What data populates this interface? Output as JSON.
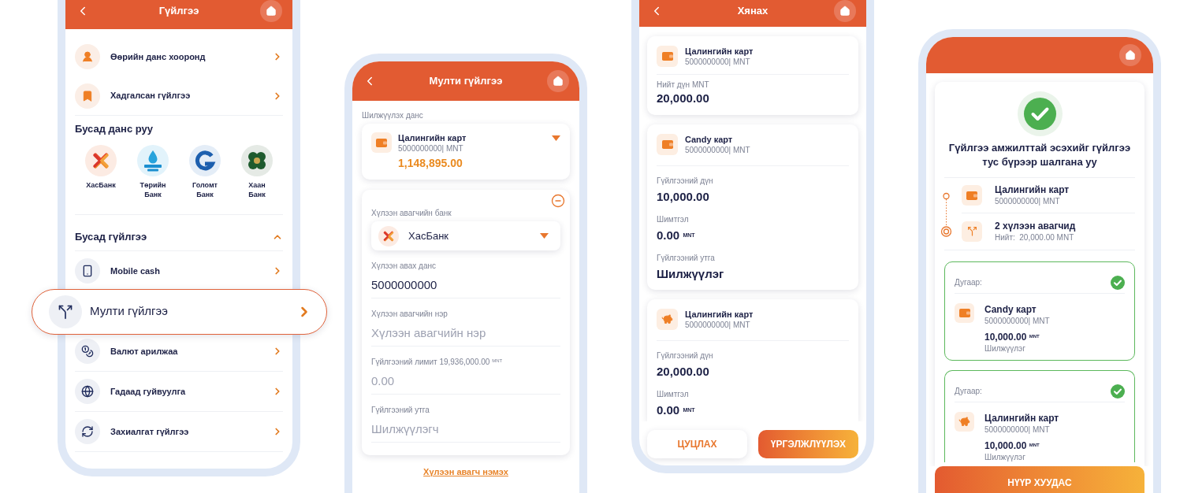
{
  "transfer_menu": {
    "title": "Гүйлгээ",
    "items": [
      {
        "label": "Өөрийн данс хооронд"
      },
      {
        "label": "Хадгалсан гүйлгээ"
      }
    ],
    "banks_section": {
      "title": "Бусад данс руу",
      "banks": [
        {
          "name": "ХасБанк"
        },
        {
          "name": "Төрийн Банк"
        },
        {
          "name": "Голомт Банк"
        },
        {
          "name": "Хаан Банк"
        }
      ]
    },
    "other_section": {
      "title": "Бусад гүйлгээ",
      "expanded": true,
      "items": [
        {
          "label": "Mobile cash",
          "selected": false
        },
        {
          "label": "Мулти гүйлгээ",
          "selected": true
        },
        {
          "label": "Валют арилжаа",
          "selected": false
        },
        {
          "label": "Гадаад гуйвуулга",
          "selected": false
        },
        {
          "label": "Захиалгат гүйлгээ",
          "selected": false
        }
      ]
    }
  },
  "multi_transfer": {
    "title": "Мулти гүйлгээ",
    "source_label": "Шилжүүлэх данс",
    "source_account": {
      "name": "Цалингийн карт",
      "number": "5000000000| MNT",
      "balance": "1,148,895.00"
    },
    "recipient": {
      "bank_label": "Хүлээн авагчийн банк",
      "bank": "ХасБанк",
      "fields": [
        {
          "label": "Хүлээн авах данс",
          "value": "5000000000"
        },
        {
          "label": "Хүлээн авагчийн нэр",
          "placeholder": "Хүлээн авагчийн нэр"
        },
        {
          "label": "Гүйлгээний лимит 19,936,000.00 $^{MNT}$",
          "placeholder": "0.00"
        },
        {
          "label": "Гүйлгээний утга",
          "placeholder": "Шилжүүлэгч"
        }
      ]
    },
    "add_recipient": "Хүлээн авагч нэмэх"
  },
  "review": {
    "title": "Хянах",
    "source": {
      "name": "Цалингийн карт",
      "number": "5000000000| MNT",
      "total_label": "Нийт дүн MNT",
      "total": "20,000.00"
    },
    "transfers": [
      {
        "kind": "wallet",
        "name": "Candy карт",
        "number": "5000000000| MNT",
        "details": [
          {
            "label": "Гүйлгээний дүн",
            "value": "10,000.00"
          },
          {
            "label": "Шимтгэл",
            "value": "0.00 $^{MNT}$"
          },
          {
            "label": "Гүйлгээний утга",
            "value": "Шилжүүлэг"
          }
        ]
      },
      {
        "kind": "piggybank",
        "name": "Цалингийн карт",
        "number": "5000000000| MNT",
        "details": [
          {
            "label": "Гүйлгээний дүн",
            "value": "20,000.00"
          },
          {
            "label": "Шимтгэл",
            "value": "0.00 $^{MNT}$"
          }
        ]
      }
    ],
    "buttons": [
      {
        "label": "ЦУЦЛАХ",
        "kind": "secondary"
      },
      {
        "label": "ҮРГЭЛЖЛҮҮЛЭХ",
        "kind": "primary"
      }
    ]
  },
  "result": {
    "message": "Гүйлгээ амжилттай эсэхийг гүйлгээ тус бүрээр шалгана уу",
    "source": {
      "name": "Цалингийн карт",
      "number": "5000000000| MNT"
    },
    "recipients": {
      "title": "2 хүлээн авагчид",
      "total": "Нийт:  20,000.00 MNT"
    },
    "transfers": [
      {
        "number_label": "Дугаар:",
        "success": true,
        "kind": "wallet",
        "name": "Candy карт",
        "number": "5000000000| MNT",
        "amount": "10,000.00 $^{MNT}$",
        "description": "Шилжүүлэг"
      },
      {
        "number_label": "Дугаар:",
        "success": true,
        "kind": "piggybank",
        "name": "Цалингийн карт",
        "number": "5000000000| MNT",
        "amount": "10,000.00 $^{MNT}$",
        "description": "Шилжүүлэг"
      }
    ],
    "button": "НҮҮР ХУУДАС"
  }
}
